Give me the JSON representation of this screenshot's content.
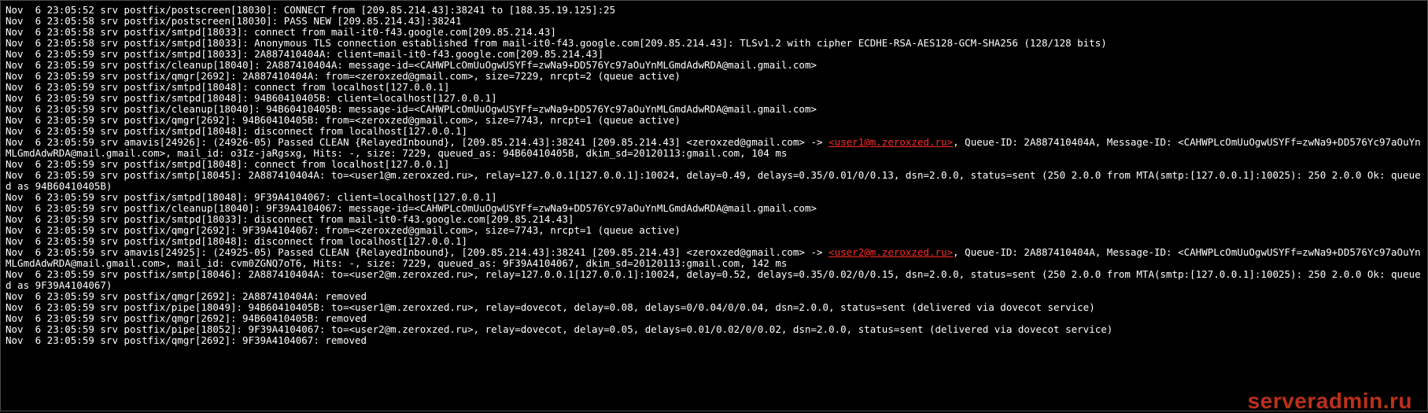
{
  "highlights": [
    "<user1@m.zeroxzed.ru>",
    "<user2@m.zeroxzed.ru>"
  ],
  "watermark": "serveradmin.ru",
  "log_lines": [
    "Nov  6 23:05:52 srv postfix/postscreen[18030]: CONNECT from [209.85.214.43]:38241 to [188.35.19.125]:25",
    "Nov  6 23:05:58 srv postfix/postscreen[18030]: PASS NEW [209.85.214.43]:38241",
    "Nov  6 23:05:58 srv postfix/smtpd[18033]: connect from mail-it0-f43.google.com[209.85.214.43]",
    "Nov  6 23:05:58 srv postfix/smtpd[18033]: Anonymous TLS connection established from mail-it0-f43.google.com[209.85.214.43]: TLSv1.2 with cipher ECDHE-RSA-AES128-GCM-SHA256 (128/128 bits)",
    "Nov  6 23:05:59 srv postfix/smtpd[18033]: 2A887410404A: client=mail-it0-f43.google.com[209.85.214.43]",
    "Nov  6 23:05:59 srv postfix/cleanup[18040]: 2A887410404A: message-id=<CAHWPLcOmUuOgwUSYFf=zwNa9+DD576Yc97aOuYnMLGmdAdwRDA@mail.gmail.com>",
    "Nov  6 23:05:59 srv postfix/qmgr[2692]: 2A887410404A: from=<zeroxzed@gmail.com>, size=7229, nrcpt=2 (queue active)",
    "Nov  6 23:05:59 srv postfix/smtpd[18048]: connect from localhost[127.0.0.1]",
    "Nov  6 23:05:59 srv postfix/smtpd[18048]: 94B60410405B: client=localhost[127.0.0.1]",
    "Nov  6 23:05:59 srv postfix/cleanup[18040]: 94B60410405B: message-id=<CAHWPLcOmUuOgwUSYFf=zwNa9+DD576Yc97aOuYnMLGmdAdwRDA@mail.gmail.com>",
    "Nov  6 23:05:59 srv postfix/qmgr[2692]: 94B60410405B: from=<zeroxzed@gmail.com>, size=7743, nrcpt=1 (queue active)",
    "Nov  6 23:05:59 srv postfix/smtpd[18048]: disconnect from localhost[127.0.0.1]",
    "Nov  6 23:05:59 srv amavis[24926]: (24926-05) Passed CLEAN {RelayedInbound}, [209.85.214.43]:38241 [209.85.214.43] <zeroxzed@gmail.com> -> <user1@m.zeroxzed.ru>, Queue-ID: 2A887410404A, Message-ID: <CAHWPLcOmUuOgwUSYFf=zwNa9+DD576Yc97aOuYnMLGmdAdwRDA@mail.gmail.com>, mail_id: o3Iz-jaRgsxg, Hits: -, size: 7229, queued_as: 94B60410405B, dkim_sd=20120113:gmail.com, 104 ms",
    "Nov  6 23:05:59 srv postfix/smtpd[18048]: connect from localhost[127.0.0.1]",
    "Nov  6 23:05:59 srv postfix/smtp[18045]: 2A887410404A: to=<user1@m.zeroxzed.ru>, relay=127.0.0.1[127.0.0.1]:10024, delay=0.49, delays=0.35/0.01/0/0.13, dsn=2.0.0, status=sent (250 2.0.0 from MTA(smtp:[127.0.0.1]:10025): 250 2.0.0 Ok: queued as 94B60410405B)",
    "Nov  6 23:05:59 srv postfix/smtpd[18048]: 9F39A4104067: client=localhost[127.0.0.1]",
    "Nov  6 23:05:59 srv postfix/cleanup[18040]: 9F39A4104067: message-id=<CAHWPLcOmUuOgwUSYFf=zwNa9+DD576Yc97aOuYnMLGmdAdwRDA@mail.gmail.com>",
    "Nov  6 23:05:59 srv postfix/smtpd[18033]: disconnect from mail-it0-f43.google.com[209.85.214.43]",
    "Nov  6 23:05:59 srv postfix/qmgr[2692]: 9F39A4104067: from=<zeroxzed@gmail.com>, size=7743, nrcpt=1 (queue active)",
    "Nov  6 23:05:59 srv postfix/smtpd[18048]: disconnect from localhost[127.0.0.1]",
    "Nov  6 23:05:59 srv amavis[24925]: (24925-05) Passed CLEAN {RelayedInbound}, [209.85.214.43]:38241 [209.85.214.43] <zeroxzed@gmail.com> -> <user2@m.zeroxzed.ru>, Queue-ID: 2A887410404A, Message-ID: <CAHWPLcOmUuOgwUSYFf=zwNa9+DD576Yc97aOuYnMLGmdAdwRDA@mail.gmail.com>, mail_id: cvm0ZGNQ7oT6, Hits: -, size: 7229, queued_as: 9F39A4104067, dkim_sd=20120113:gmail.com, 142 ms",
    "Nov  6 23:05:59 srv postfix/smtp[18046]: 2A887410404A: to=<user2@m.zeroxzed.ru>, relay=127.0.0.1[127.0.0.1]:10024, delay=0.52, delays=0.35/0.02/0/0.15, dsn=2.0.0, status=sent (250 2.0.0 from MTA(smtp:[127.0.0.1]:10025): 250 2.0.0 Ok: queued as 9F39A4104067)",
    "Nov  6 23:05:59 srv postfix/qmgr[2692]: 2A887410404A: removed",
    "Nov  6 23:05:59 srv postfix/pipe[18049]: 94B60410405B: to=<user1@m.zeroxzed.ru>, relay=dovecot, delay=0.08, delays=0/0.04/0/0.04, dsn=2.0.0, status=sent (delivered via dovecot service)",
    "Nov  6 23:05:59 srv postfix/qmgr[2692]: 94B60410405B: removed",
    "Nov  6 23:05:59 srv postfix/pipe[18052]: 9F39A4104067: to=<user2@m.zeroxzed.ru>, relay=dovecot, delay=0.05, delays=0.01/0.02/0/0.02, dsn=2.0.0, status=sent (delivered via dovecot service)",
    "Nov  6 23:05:59 srv postfix/qmgr[2692]: 9F39A4104067: removed"
  ]
}
